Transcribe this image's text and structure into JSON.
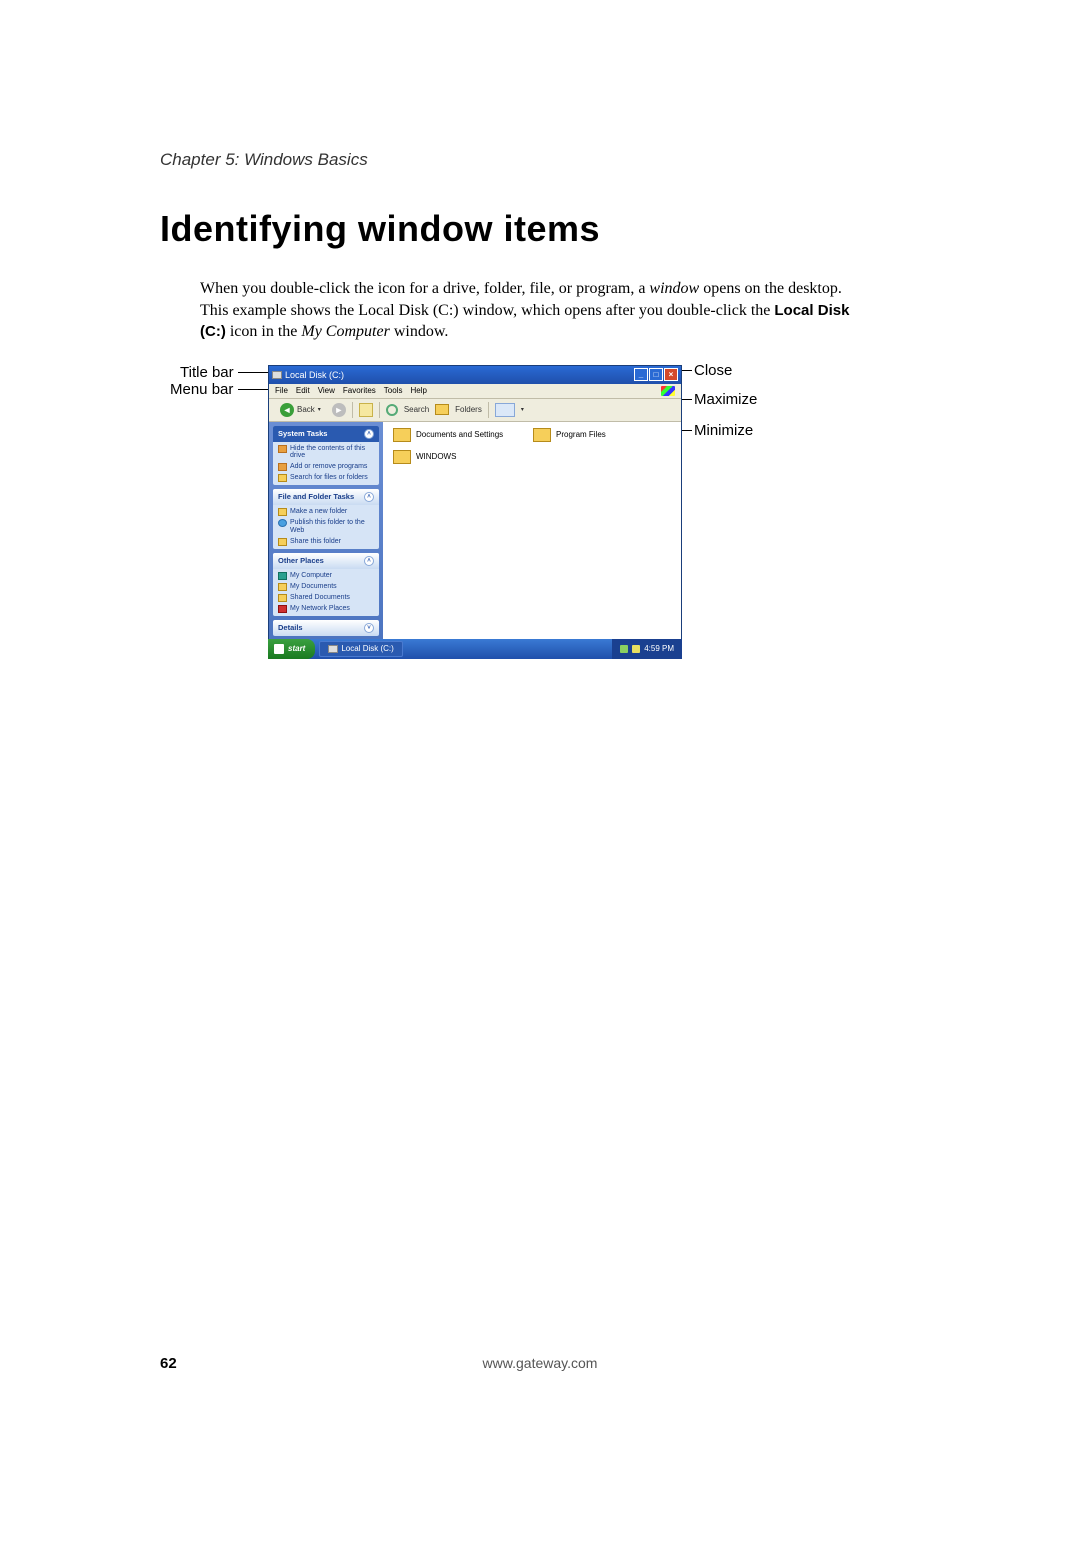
{
  "chapter": "Chapter 5: Windows Basics",
  "heading": "Identifying window items",
  "paragraph": {
    "p1": "When you double-click the icon for a drive, folder, file, or program, a ",
    "i1": "window",
    "p2": " opens on the desktop. This example shows the Local Disk (C:) window, which opens after you double-click the ",
    "b1": "Local Disk (C:)",
    "p3": " icon in the ",
    "i2": "My Computer",
    "p4": " window."
  },
  "callouts": {
    "title_bar": "Title bar",
    "menu_bar": "Menu bar",
    "close": "Close",
    "maximize": "Maximize",
    "minimize": "Minimize"
  },
  "xp": {
    "title": "Local Disk (C:)",
    "menus": [
      "File",
      "Edit",
      "View",
      "Favorites",
      "Tools",
      "Help"
    ],
    "toolbar": {
      "back": "Back",
      "search": "Search",
      "folders": "Folders"
    },
    "panels": {
      "system": {
        "head": "System Tasks",
        "items": [
          "Hide the contents of this drive",
          "Add or remove programs",
          "Search for files or folders"
        ]
      },
      "filefolder": {
        "head": "File and Folder Tasks",
        "items": [
          "Make a new folder",
          "Publish this folder to the Web",
          "Share this folder"
        ]
      },
      "other": {
        "head": "Other Places",
        "items": [
          "My Computer",
          "My Documents",
          "Shared Documents",
          "My Network Places"
        ]
      },
      "details": {
        "head": "Details"
      }
    },
    "content_items": [
      "Documents and Settings",
      "Program Files",
      "WINDOWS"
    ],
    "taskbar": {
      "start": "start",
      "task": "Local Disk (C:)",
      "clock": "4:59 PM"
    }
  },
  "footer": {
    "page": "62",
    "url": "www.gateway.com"
  }
}
